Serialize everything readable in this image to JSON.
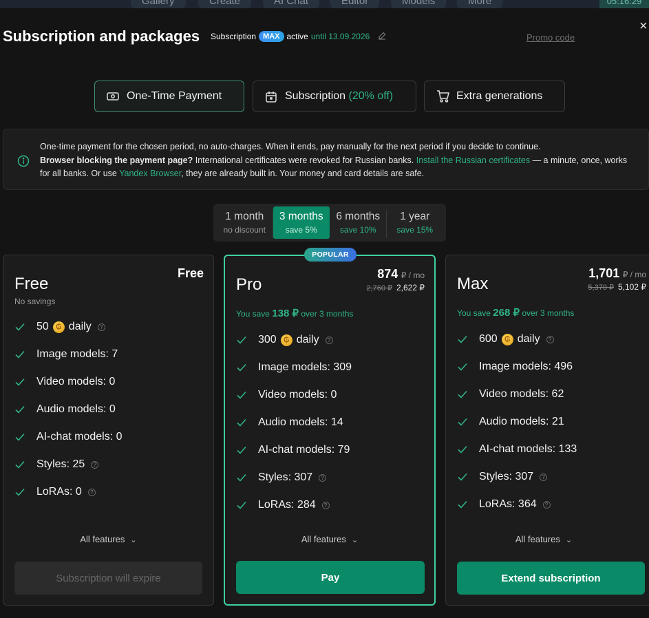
{
  "topnav": {
    "tabs": [
      "Gallery",
      "Create",
      "AI Chat",
      "Editor",
      "Models",
      "More"
    ],
    "clock": "05:16:29"
  },
  "header": {
    "title": "Subscription and packages",
    "subscription_label": "Subscription",
    "plan_badge": "MAX",
    "status": "active",
    "until": "until 13.09.2026",
    "promo_code": "Promo code"
  },
  "payment_tabs": [
    {
      "label": "One-Time Payment",
      "icon": "cash-icon",
      "active": true
    },
    {
      "label": "Subscription",
      "extra": "(20% off)",
      "icon": "calendar-icon",
      "active": false
    },
    {
      "label": "Extra generations",
      "icon": "cart-icon",
      "active": false
    }
  ],
  "info": {
    "line1": "One-time payment for the chosen period, no auto-charges. When it ends, pay manually for the next period if you decide to continue.",
    "bold": "Browser blocking the payment page?",
    "line2a": " International certificates were revoked for Russian banks. ",
    "link1": "Install the Russian certificates",
    "line2b": " — a minute, once, works for all banks. Or use ",
    "link2": "Yandex Browser",
    "line2c": ", they are already built in. Your money and card details are safe."
  },
  "periods": [
    {
      "name": "1 month",
      "sub": "no discount",
      "selected": false
    },
    {
      "name": "3 months",
      "sub": "save 5%",
      "selected": true
    },
    {
      "name": "6 months",
      "sub": "save 10%",
      "selected": false
    },
    {
      "name": "1 year",
      "sub": "save 15%",
      "selected": false
    }
  ],
  "plans": {
    "free": {
      "name": "Free",
      "price": "Free",
      "savings": "No savings",
      "features": [
        "50",
        "Image models: 7",
        "Video models: 0",
        "Audio models: 0",
        "AI-chat models: 0",
        "Styles: 25",
        "LoRAs: 0"
      ],
      "daily": "daily",
      "all_features": "All features",
      "button": "Subscription will expire"
    },
    "pro": {
      "name": "Pro",
      "badge": "POPULAR",
      "price": "874",
      "per": "₽ / mo",
      "old_total": "2,760 ₽",
      "total": "2,622 ₽",
      "save_prefix": "You save",
      "save_amount": "138 ₽",
      "save_suffix": "over 3 months",
      "features": [
        "300",
        "Image models: 309",
        "Video models: 0",
        "Audio models: 14",
        "AI-chat models: 79",
        "Styles: 307",
        "LoRAs: 284"
      ],
      "daily": "daily",
      "all_features": "All features",
      "button": "Pay"
    },
    "max": {
      "name": "Max",
      "price": "1,701",
      "per": "₽ / mo",
      "old_total": "5,370 ₽",
      "total": "5,102 ₽",
      "save_prefix": "You save",
      "save_amount": "268 ₽",
      "save_suffix": "over 3 months",
      "features": [
        "600",
        "Image models: 496",
        "Video models: 62",
        "Audio models: 21",
        "AI-chat models: 133",
        "Styles: 307",
        "LoRAs: 364"
      ],
      "daily": "daily",
      "all_features": "All features",
      "button": "Extend subscription"
    }
  },
  "colors": {
    "accent": "#0a8a67",
    "accent_text": "#2fb487",
    "popular_border": "#3fd1a4"
  }
}
